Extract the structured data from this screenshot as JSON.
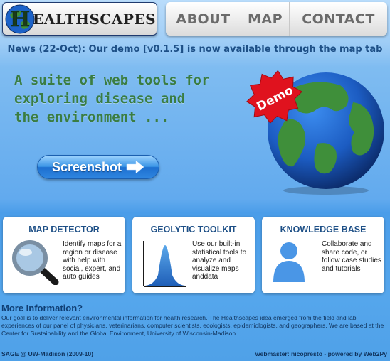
{
  "header": {
    "logo_letter": "H",
    "logo_text": "EALTHSCAPES"
  },
  "nav": {
    "items": [
      {
        "label": "ABOUT"
      },
      {
        "label": "MAP"
      },
      {
        "label": "CONTACT"
      }
    ]
  },
  "news": "News (22-Oct): Our demo [v0.1.5] is now available through the map tab",
  "hero": {
    "lines": [
      "A suite of web tools for",
      "exploring disease and",
      "the environment ..."
    ],
    "button_label": "Screenshot",
    "badge": "Demo"
  },
  "cards": [
    {
      "title": "MAP DETECTOR",
      "icon": "magnifier-icon",
      "desc": "Identify maps for a region or disease with help with social, expert, and auto guides"
    },
    {
      "title": "GEOLYTIC TOOLKIT",
      "icon": "chart-icon",
      "desc": "Use our built-in statistical tools to analyze and visualize maps anddata"
    },
    {
      "title": "KNOWLEDGE BASE",
      "icon": "user-icon",
      "desc": "Collaborate and share code, or follow case studies and tutorials"
    }
  ],
  "more_info": {
    "title": "More Information?",
    "text": "Our goal is to deliver relevant environmental information for health research. The Healthscapes idea emerged from the field and lab experiences of our panel of physicians, veterinarians, computer scientists, ecologists, epidemiologists, and geographers. We are based at the Center for Sustainability and the Global Environment, University of Wisconsin-Madison."
  },
  "footer": {
    "left": "SAGE @ UW-Madison (2009-10)",
    "right": "webmaster: nicopresto - powered by Web2Py"
  },
  "colors": {
    "accent": "#1d4f86",
    "hero_text": "#3a7d43",
    "badge": "#e0121e",
    "ocean": "#1c62c8",
    "land": "#3f8f3a"
  }
}
